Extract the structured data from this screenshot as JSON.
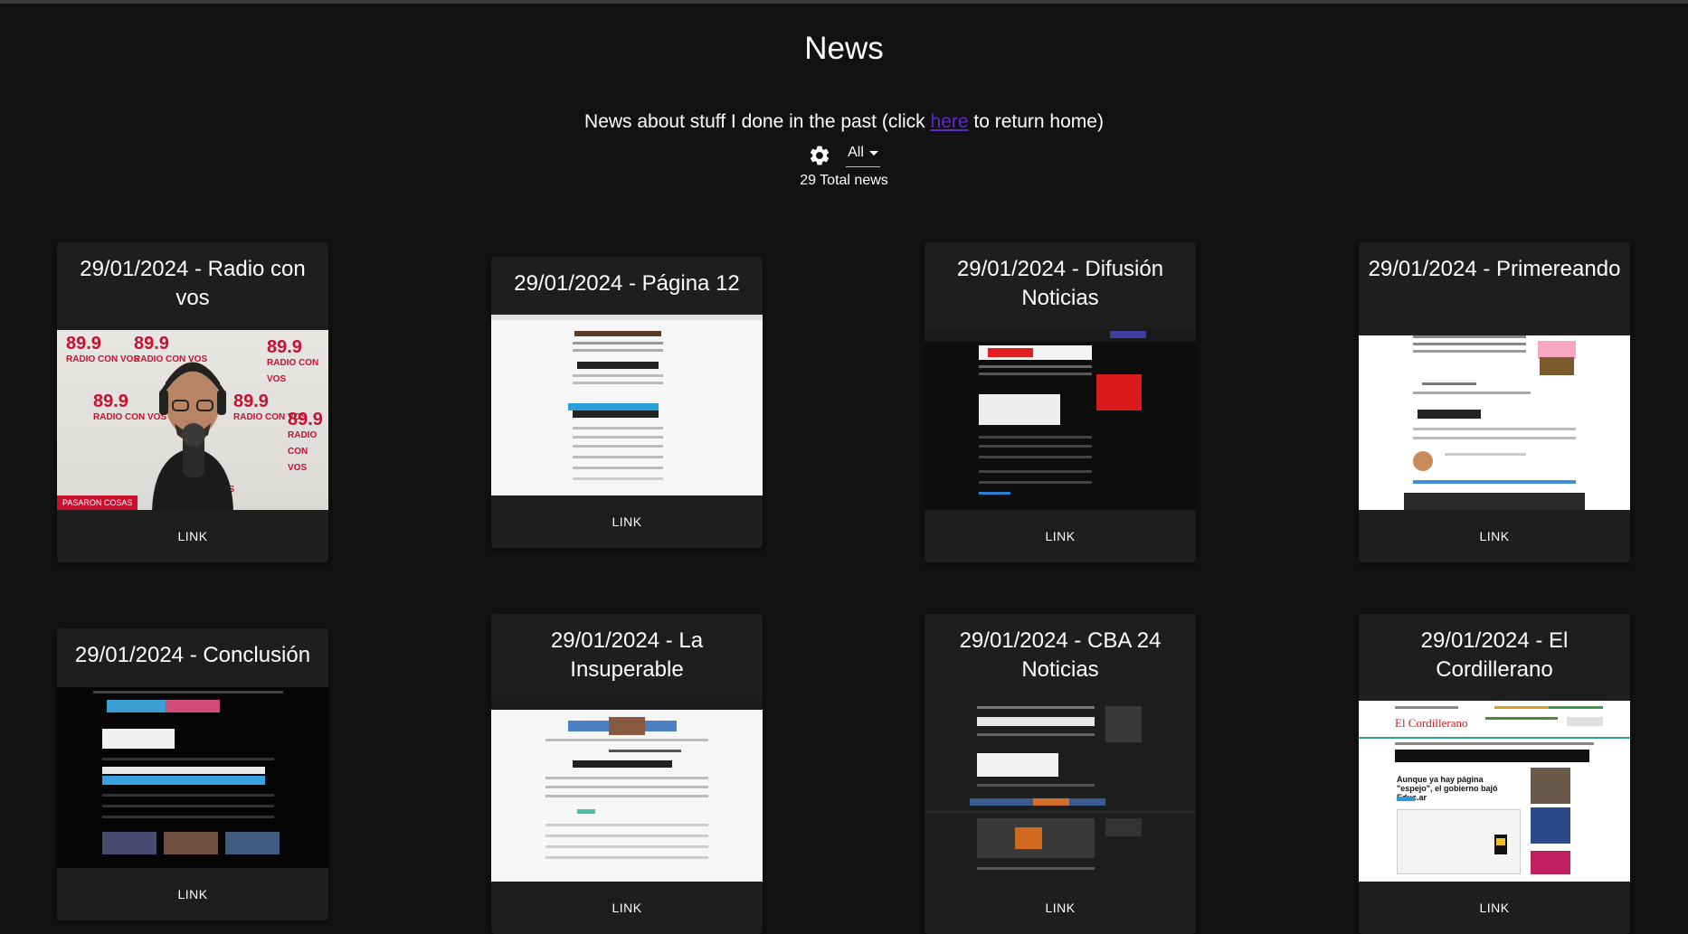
{
  "page": {
    "title": "News",
    "subtitle_before": "News about stuff I done in the past (click ",
    "subtitle_link": "here",
    "subtitle_after": " to return home)",
    "filter_selected": "All",
    "total": "29 Total news"
  },
  "cards": [
    {
      "title": "29/01/2024 - Radio con vos",
      "link": "LINK",
      "thumb_text": "PASARON COSAS",
      "logo_text": "89.9",
      "logo_sub": "RADIO CON VOS"
    },
    {
      "title": "29/01/2024 - Página 12",
      "link": "LINK"
    },
    {
      "title": "29/01/2024 - Difusión Noticias",
      "link": "LINK"
    },
    {
      "title": "29/01/2024 - Primereando",
      "link": "LINK"
    },
    {
      "title": "29/01/2024 - Conclusión",
      "link": "LINK"
    },
    {
      "title": "29/01/2024 - La Insuperable",
      "link": "LINK"
    },
    {
      "title": "29/01/2024 - CBA 24 Noticias",
      "link": "LINK"
    },
    {
      "title": "29/01/2024 - El Cordillerano",
      "link": "LINK",
      "thumb_text": "El Cordillerano",
      "headline": "Aunque ya hay página \"espejo\", el gobierno bajó Educ.ar"
    }
  ],
  "colors": {
    "background": "#121212",
    "card": "#1e1e1e",
    "link_accent": "#5b2bc4",
    "radio_red": "#c8102e"
  },
  "icons": {
    "theme_toggle": "gear-icon",
    "dropdown": "caret-down-icon"
  }
}
